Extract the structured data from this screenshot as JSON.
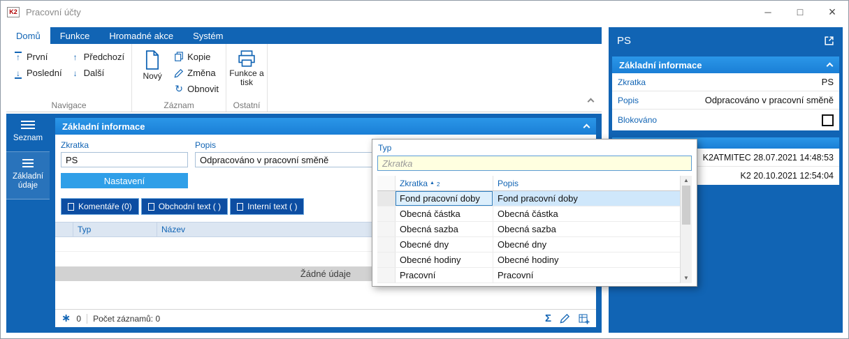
{
  "window": {
    "title": "Pracovní účty",
    "logo_text": "K2"
  },
  "icons": {
    "minimize": "─",
    "maximize": "□",
    "close": "×",
    "up_arrow": "↑",
    "down_arrow": "↓",
    "refresh": "↻",
    "asterisk": "∗",
    "sigma": "Σ",
    "sort_asc": "▲",
    "scroll_up": "▲",
    "scroll_down": "▼"
  },
  "ribbon": {
    "tabs": [
      {
        "label": "Domů",
        "active": true
      },
      {
        "label": "Funkce",
        "active": false
      },
      {
        "label": "Hromadné akce",
        "active": false
      },
      {
        "label": "Systém",
        "active": false
      }
    ],
    "navigation": {
      "first": "První",
      "last": "Poslední",
      "previous": "Předchozí",
      "next": "Další",
      "group_label": "Navigace"
    },
    "record": {
      "new": "Nový",
      "copy": "Kopie",
      "change": "Změna",
      "refresh": "Obnovit",
      "group_label": "Záznam"
    },
    "other": {
      "function_print": "Funkce a tisk",
      "group_label": "Ostatní"
    }
  },
  "sidebar": {
    "items": [
      {
        "label": "Seznam"
      },
      {
        "label": "Základní údaje"
      }
    ]
  },
  "main": {
    "section_title": "Základní informace",
    "fields": {
      "zkratka_label": "Zkratka",
      "zkratka_value": "PS",
      "popis_label": "Popis",
      "popis_value": "Odpracováno v pracovní směně"
    },
    "settings_button": "Nastavení",
    "tabs": [
      {
        "label": "Komentáře (0)"
      },
      {
        "label": "Obchodní text ( )"
      },
      {
        "label": "Interní text ( )"
      }
    ],
    "table": {
      "col_typ": "Typ",
      "col_nazev": "Název",
      "empty_text": "Žádné údaje"
    },
    "statusbar": {
      "marked_count": "0",
      "records_label": "Počet záznamů: 0"
    }
  },
  "dropdown": {
    "title": "Typ",
    "search_placeholder": "Zkratka",
    "col_zkratka": "Zkratka",
    "sort_order": "2",
    "col_popis": "Popis",
    "rows": [
      {
        "zkratka": "Fond pracovní doby",
        "popis": "Fond pracovní doby",
        "selected": true
      },
      {
        "zkratka": "Obecná částka",
        "popis": "Obecná částka",
        "selected": false
      },
      {
        "zkratka": "Obecná sazba",
        "popis": "Obecná sazba",
        "selected": false
      },
      {
        "zkratka": "Obecné dny",
        "popis": "Obecné dny",
        "selected": false
      },
      {
        "zkratka": "Obecné hodiny",
        "popis": "Obecné hodiny",
        "selected": false
      },
      {
        "zkratka": "Pracovní",
        "popis": "Pracovní",
        "selected": false
      }
    ]
  },
  "right_panel": {
    "title": "PS",
    "section_title": "Základní informace",
    "zkratka_label": "Zkratka",
    "zkratka_value": "PS",
    "popis_label": "Popis",
    "popis_value": "Odpracováno v pracovní směně",
    "blokovano_label": "Blokováno",
    "audit_row1": "K2ATMITEC 28.07.2021 14:48:53",
    "audit_row2": "K2 20.10.2021 12:54:04"
  },
  "colors": {
    "accent_blue": "#1164b4",
    "section_header_blue": "#1e87dd",
    "tab_dark_blue": "#0c4da2",
    "selection_blue": "#cfe7fb",
    "search_bg_yellow": "#ffffe0"
  }
}
